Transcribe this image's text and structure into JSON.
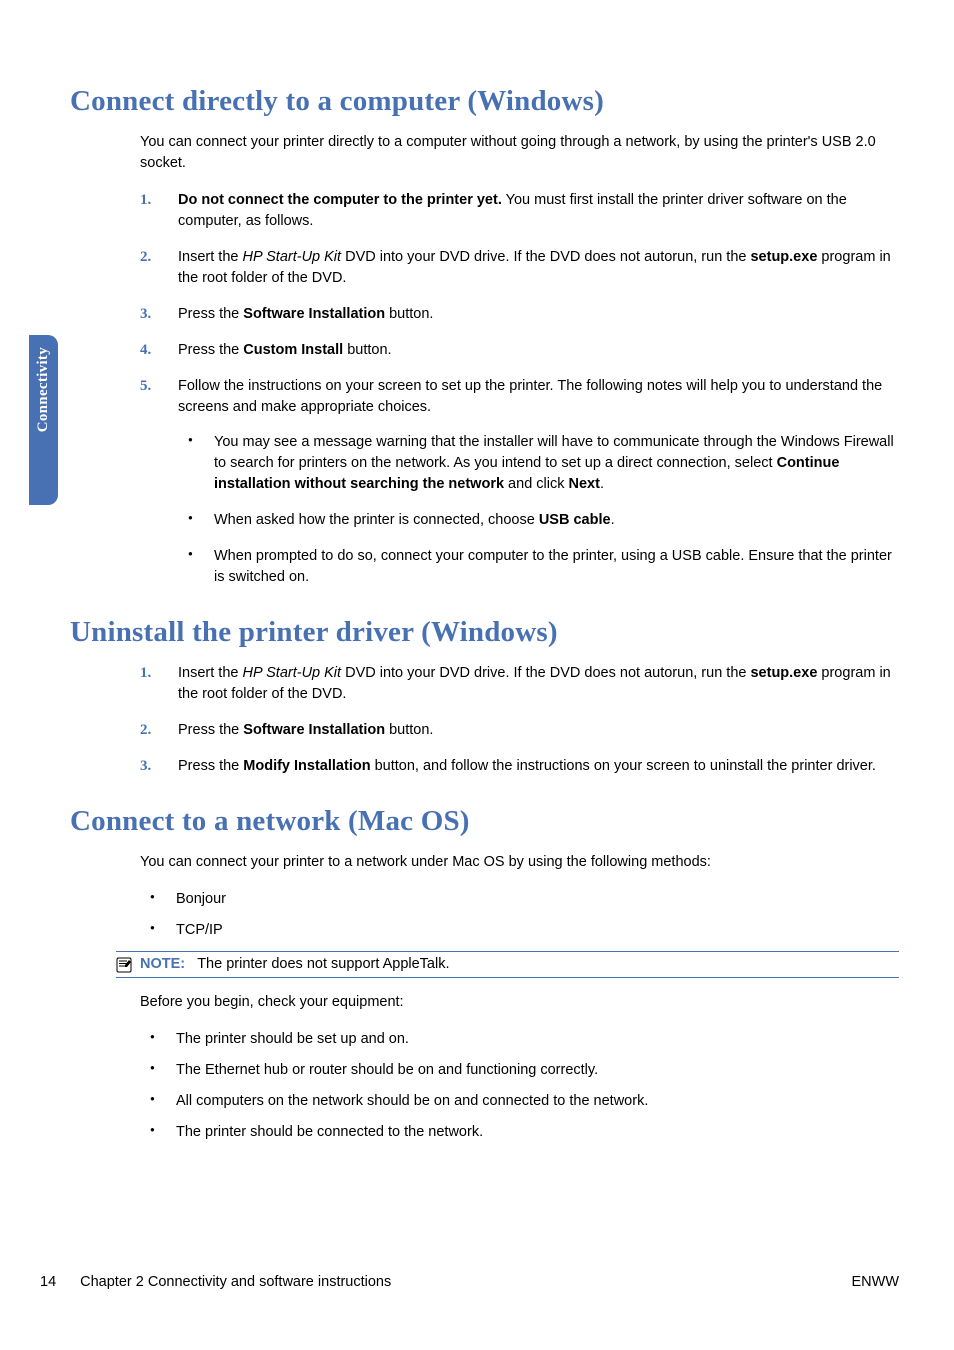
{
  "sideTab": "Connectivity",
  "sections": {
    "s1": {
      "title": "Connect directly to a computer (Windows)",
      "intro": "You can connect your printer directly to a computer without going through a network, by using the printer's USB 2.0 socket.",
      "steps": {
        "n1": "1.",
        "t1a": "Do not connect the computer to the printer yet.",
        "t1b": " You must first install the printer driver software on the computer, as follows.",
        "n2": "2.",
        "t2a": "Insert the ",
        "t2b": "HP Start-Up Kit",
        "t2c": " DVD into your DVD drive. If the DVD does not autorun, run the ",
        "t2d": "setup.exe",
        "t2e": " program in the root folder of the DVD.",
        "n3": "3.",
        "t3a": "Press the ",
        "t3b": "Software Installation",
        "t3c": " button.",
        "n4": "4.",
        "t4a": "Press the ",
        "t4b": "Custom Install",
        "t4c": " button.",
        "n5": "5.",
        "t5": "Follow the instructions on your screen to set up the printer. The following notes will help you to understand the screens and make appropriate choices.",
        "b1a": "You may see a message warning that the installer will have to communicate through the Windows Firewall to search for printers on the network. As you intend to set up a direct connection, select ",
        "b1b": "Continue installation without searching the network",
        "b1c": " and click ",
        "b1d": "Next",
        "b1e": ".",
        "b2a": "When asked how the printer is connected, choose ",
        "b2b": "USB cable",
        "b2c": ".",
        "b3": "When prompted to do so, connect your computer to the printer, using a USB cable. Ensure that the printer is switched on."
      }
    },
    "s2": {
      "title": "Uninstall the printer driver (Windows)",
      "steps": {
        "n1": "1.",
        "t1a": "Insert the ",
        "t1b": "HP Start-Up Kit",
        "t1c": " DVD into your DVD drive. If the DVD does not autorun, run the ",
        "t1d": "setup.exe",
        "t1e": " program in the root folder of the DVD.",
        "n2": "2.",
        "t2a": "Press the ",
        "t2b": "Software Installation",
        "t2c": " button.",
        "n3": "3.",
        "t3a": "Press the ",
        "t3b": "Modify Installation",
        "t3c": " button, and follow the instructions on your screen to uninstall the printer driver."
      }
    },
    "s3": {
      "title": "Connect to a network (Mac OS)",
      "intro": "You can connect your printer to a network under Mac OS by using the following methods:",
      "methods": {
        "m1": "Bonjour",
        "m2": "TCP/IP"
      },
      "noteLabel": "NOTE:",
      "noteText": "The printer does not support AppleTalk.",
      "before": "Before you begin, check your equipment:",
      "checks": {
        "c1": "The printer should be set up and on.",
        "c2": "The Ethernet hub or router should be on and functioning correctly.",
        "c3": "All computers on the network should be on and connected to the network.",
        "c4": "The printer should be connected to the network."
      }
    }
  },
  "footer": {
    "page": "14",
    "chapter": "Chapter 2   Connectivity and software instructions",
    "right": "ENWW"
  }
}
